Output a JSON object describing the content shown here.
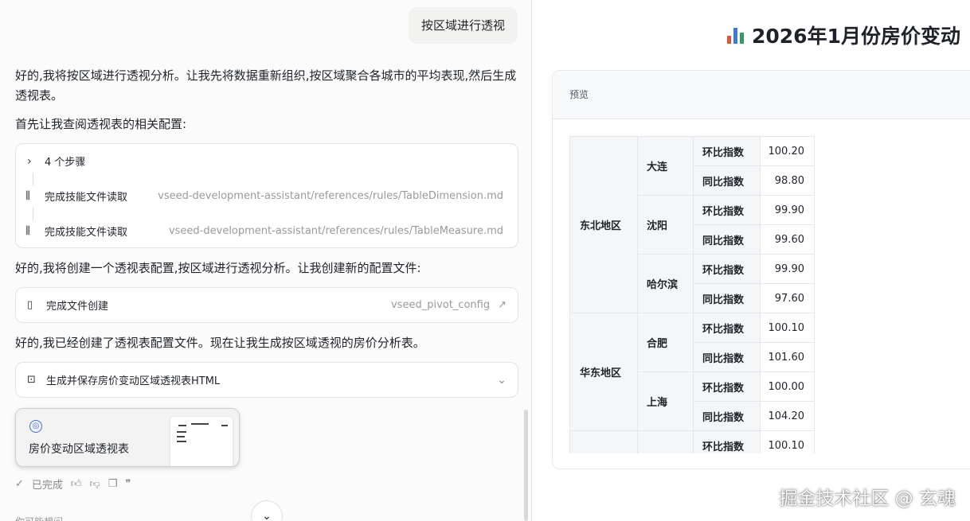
{
  "chat": {
    "user_message": "按区域进行透视",
    "msg1": "好的,我将按区域进行透视分析。让我先将数据重新组织,按区域聚合各城市的平均表现,然后生成透视表。",
    "msg2": "首先让我查阅透视表的相关配置:",
    "steps": {
      "header": "4 个步骤",
      "items": [
        {
          "label": "完成技能文件读取",
          "path": "vseed-development-assistant/references/rules/TableDimension.md"
        },
        {
          "label": "完成技能文件读取",
          "path": "vseed-development-assistant/references/rules/TableMeasure.md"
        }
      ]
    },
    "msg3": "好的,我将创建一个透视表配置,按区域进行透视分析。让我创建新的配置文件:",
    "file_card": {
      "label": "完成文件创建",
      "file": "vseed_pivot_config"
    },
    "msg4": "好的,我已经创建了透视表配置文件。现在让我生成按区域透视的房价分析表。",
    "gen_card": {
      "label": "生成并保存房价变动区域透视表HTML"
    },
    "artifact": {
      "title": "房价变动区域透视表"
    },
    "status": "已完成",
    "suggest": "你可能想问"
  },
  "preview": {
    "title": "2026年1月份房价变动",
    "panel_label": "预览",
    "rows": [
      {
        "region": "东北地区",
        "city": "大连",
        "metric": "环比指数",
        "value": "100.20"
      },
      {
        "region": "东北地区",
        "city": "大连",
        "metric": "同比指数",
        "value": "98.80"
      },
      {
        "region": "东北地区",
        "city": "沈阳",
        "metric": "环比指数",
        "value": "99.90"
      },
      {
        "region": "东北地区",
        "city": "沈阳",
        "metric": "同比指数",
        "value": "99.60"
      },
      {
        "region": "东北地区",
        "city": "哈尔滨",
        "metric": "环比指数",
        "value": "99.90"
      },
      {
        "region": "东北地区",
        "city": "哈尔滨",
        "metric": "同比指数",
        "value": "97.60"
      },
      {
        "region": "华东地区",
        "city": "合肥",
        "metric": "环比指数",
        "value": "100.10"
      },
      {
        "region": "华东地区",
        "city": "合肥",
        "metric": "同比指数",
        "value": "101.60"
      },
      {
        "region": "华东地区",
        "city": "上海",
        "metric": "环比指数",
        "value": "100.00"
      },
      {
        "region": "华东地区",
        "city": "上海",
        "metric": "同比指数",
        "value": "104.20"
      },
      {
        "region": "",
        "city": "",
        "metric": "环比指数",
        "value": "100.10"
      }
    ]
  },
  "watermark": "掘金技术社区 @ 玄魂"
}
